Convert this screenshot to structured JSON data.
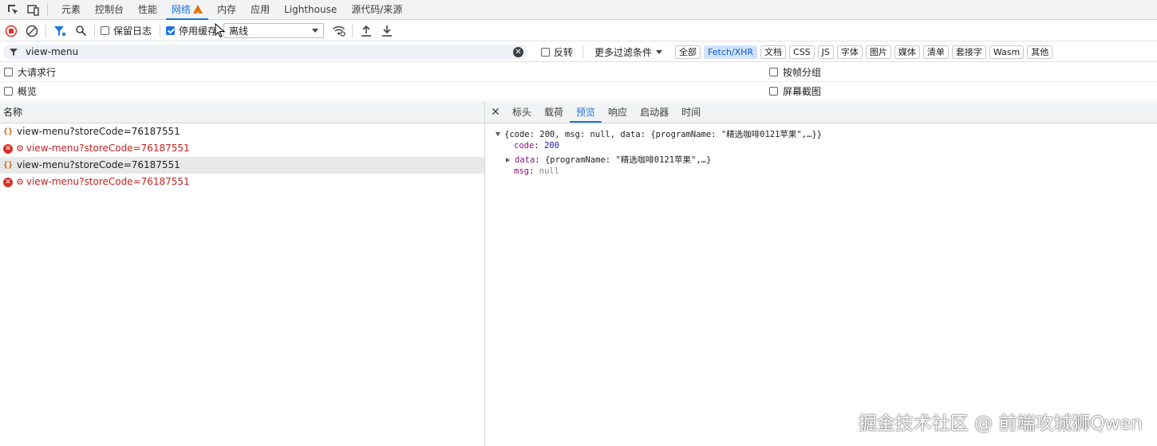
{
  "tabs": [
    {
      "label": "元素"
    },
    {
      "label": "控制台"
    },
    {
      "label": "性能"
    },
    {
      "label": "网络",
      "active": true,
      "warning": true
    },
    {
      "label": "内存"
    },
    {
      "label": "应用"
    },
    {
      "label": "Lighthouse"
    },
    {
      "label": "源代码/来源"
    }
  ],
  "toolbar": {
    "preserve_log_label": "保留日志",
    "disable_cache_label": "停用缓存",
    "throttle_value": "离线"
  },
  "filter": {
    "value": "view-menu",
    "invert_label": "反转",
    "more_filters_label": "更多过滤条件",
    "types": [
      "全部",
      "Fetch/XHR",
      "文档",
      "CSS",
      "JS",
      "字体",
      "图片",
      "媒体",
      "清单",
      "套接字",
      "Wasm",
      "其他"
    ],
    "active_type": "Fetch/XHR"
  },
  "options": {
    "big_rows": "大请求行",
    "group_by_frame": "按帧分组",
    "overview": "概览",
    "screenshots": "屏幕截图"
  },
  "requests": {
    "header": "名称",
    "rows": [
      {
        "name": "view-menu?storeCode=76187551",
        "status": "ok"
      },
      {
        "name": "view-menu?storeCode=76187551",
        "status": "error"
      },
      {
        "name": "view-menu?storeCode=76187551",
        "status": "ok",
        "selected": true
      },
      {
        "name": "view-menu?storeCode=76187551",
        "status": "error"
      }
    ]
  },
  "detail": {
    "tabs": [
      "标头",
      "载荷",
      "预览",
      "响应",
      "启动器",
      "时间"
    ],
    "active_tab": "预览",
    "preview": {
      "summary": "{code: 200, msg: null, data: {programName: \"精选咖啡0121苹果\",…}}",
      "code_key": "code",
      "code_value": "200",
      "data_key": "data",
      "data_value": "{programName: \"精选咖啡0121苹果\",…}",
      "msg_key": "msg",
      "msg_value": "null"
    }
  },
  "watermark": "掘金技术社区 @ 前端攻城狮Qwen"
}
